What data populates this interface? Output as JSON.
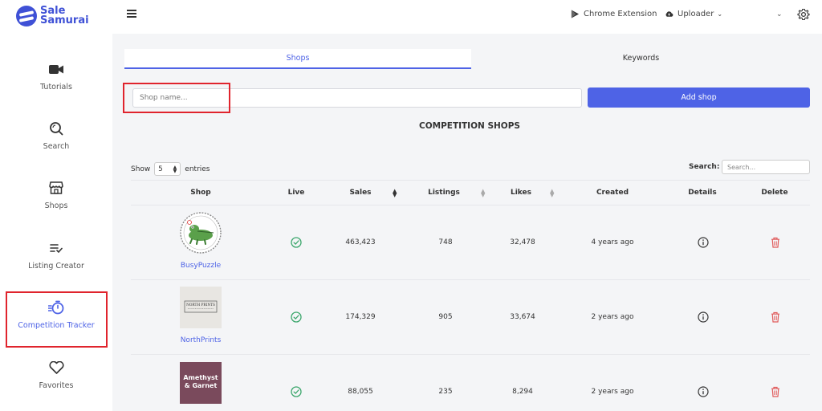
{
  "app": {
    "logo_line1": "Sale",
    "logo_line2": "Samurai",
    "brand_color": "#4e63e6"
  },
  "topbar": {
    "chrome_extension": "Chrome Extension",
    "uploader": "Uploader"
  },
  "sidebar": {
    "items": [
      {
        "label": "Tutorials",
        "icon": "video-camera-icon"
      },
      {
        "label": "Search",
        "icon": "search-icon"
      },
      {
        "label": "Shops",
        "icon": "store-icon"
      },
      {
        "label": "Listing Creator",
        "icon": "list-check-icon"
      },
      {
        "label": "Competition Tracker",
        "icon": "stopwatch-icon",
        "active": true
      },
      {
        "label": "Favorites",
        "icon": "heart-icon"
      }
    ]
  },
  "tabs": [
    {
      "label": "Shops",
      "active": true
    },
    {
      "label": "Keywords",
      "active": false
    }
  ],
  "add_shop": {
    "placeholder": "Shop name...",
    "button": "Add shop"
  },
  "section_title": "COMPETITION SHOPS",
  "table_controls": {
    "show": "Show",
    "entries_value": "5",
    "entries": "entries",
    "search_label": "Search:",
    "search_placeholder": "Search..."
  },
  "columns": [
    "Shop",
    "Live",
    "Sales",
    "Listings",
    "Likes",
    "Created",
    "Details",
    "Delete"
  ],
  "rows": [
    {
      "name": "BusyPuzzle",
      "sales": "463,423",
      "listings": "748",
      "likes": "32,478",
      "created": "4 years ago",
      "logo": "crocodile-badge"
    },
    {
      "name": "NorthPrints",
      "sales": "174,329",
      "listings": "905",
      "likes": "33,674",
      "created": "2 years ago",
      "logo": "north-prints-card",
      "logo_text": "NORTH PRINTS"
    },
    {
      "name": "Amethyst & Garnet",
      "sales": "88,055",
      "listings": "235",
      "likes": "8,294",
      "created": "2 years ago",
      "logo": "amethyst-garnet-tile",
      "logo_text_1": "Amethyst",
      "logo_text_2": "& Garnet"
    }
  ]
}
